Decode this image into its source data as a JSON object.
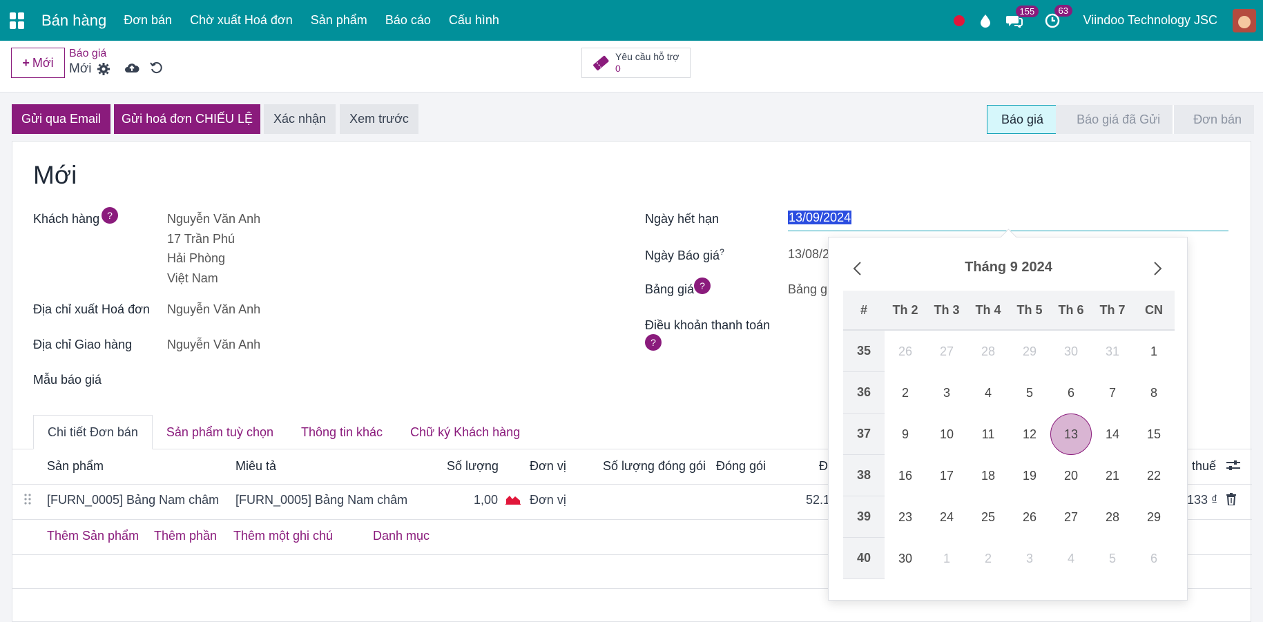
{
  "navbar": {
    "app_title": "Bán hàng",
    "menu": [
      "Đơn bán",
      "Chờ xuất Hoá đơn",
      "Sản phẩm",
      "Báo cáo",
      "Cấu hình"
    ],
    "messages_badge": "155",
    "activities_badge": "63",
    "company": "Viindoo Technology JSC"
  },
  "control": {
    "new_button": "Mới",
    "breadcrumb_parent": "Báo giá",
    "breadcrumb_current": "Mới",
    "support_label": "Yêu cầu hỗ trợ",
    "support_count": "0"
  },
  "actions": {
    "send_email": "Gửi qua Email",
    "send_proforma": "Gửi hoá đơn CHIẾU LỆ",
    "confirm": "Xác nhận",
    "preview": "Xem trước"
  },
  "status_stages": [
    "Báo giá",
    "Báo giá đã Gửi",
    "Đơn bán"
  ],
  "form": {
    "title": "Mới",
    "customer_label": "Khách hàng",
    "customer_lines": [
      "Nguyễn Văn Anh",
      "17 Trần Phú",
      "Hải Phòng",
      "Việt Nam"
    ],
    "invoice_address_label": "Địa chỉ xuất Hoá đơn",
    "invoice_address_value": "Nguyễn Văn Anh",
    "delivery_address_label": "Địa chỉ Giao hàng",
    "delivery_address_value": "Nguyễn Văn Anh",
    "template_label": "Mẫu báo giá",
    "expiry_label": "Ngày hết hạn",
    "expiry_value": "13/09/2024",
    "quote_date_label": "Ngày Báo giá",
    "quote_date_value": "13/08/2",
    "pricelist_label": "Bảng giá",
    "pricelist_value": "Bảng g",
    "payment_terms_label": "Điều khoản thanh toán",
    "help_mark": "?"
  },
  "tabs": [
    "Chi tiết Đơn bán",
    "Sản phẩm tuỳ chọn",
    "Thông tin khác",
    "Chữ ký Khách hàng"
  ],
  "table": {
    "headers": [
      "Sản phẩm",
      "Miêu tả",
      "Số lượng",
      "Đơn vị",
      "Số lượng đóng gói",
      "Đóng gói",
      "Đ",
      "thuế"
    ],
    "row": {
      "product": "[FURN_0005] Bảng Nam châm",
      "description": "[FURN_0005] Bảng Nam châm",
      "quantity": "1,00",
      "uom": "Đơn vị",
      "price": "52.1",
      "subtotal": "133 ₫"
    },
    "add_links": [
      "Thêm Sản phẩm",
      "Thêm phần",
      "Thêm một ghi chú",
      "Danh mục"
    ]
  },
  "calendar": {
    "title": "Tháng 9 2024",
    "week_col": "#",
    "days": [
      "Th 2",
      "Th 3",
      "Th 4",
      "Th 5",
      "Th 6",
      "Th 7",
      "CN"
    ],
    "weeks": [
      {
        "no": "35",
        "days": [
          "26",
          "27",
          "28",
          "29",
          "30",
          "31",
          "1"
        ]
      },
      {
        "no": "36",
        "days": [
          "2",
          "3",
          "4",
          "5",
          "6",
          "7",
          "8"
        ]
      },
      {
        "no": "37",
        "days": [
          "9",
          "10",
          "11",
          "12",
          "13",
          "14",
          "15"
        ]
      },
      {
        "no": "38",
        "days": [
          "16",
          "17",
          "18",
          "19",
          "20",
          "21",
          "22"
        ]
      },
      {
        "no": "39",
        "days": [
          "23",
          "24",
          "25",
          "26",
          "27",
          "28",
          "29"
        ]
      },
      {
        "no": "40",
        "days": [
          "30",
          "1",
          "2",
          "3",
          "4",
          "5",
          "6"
        ]
      }
    ]
  }
}
